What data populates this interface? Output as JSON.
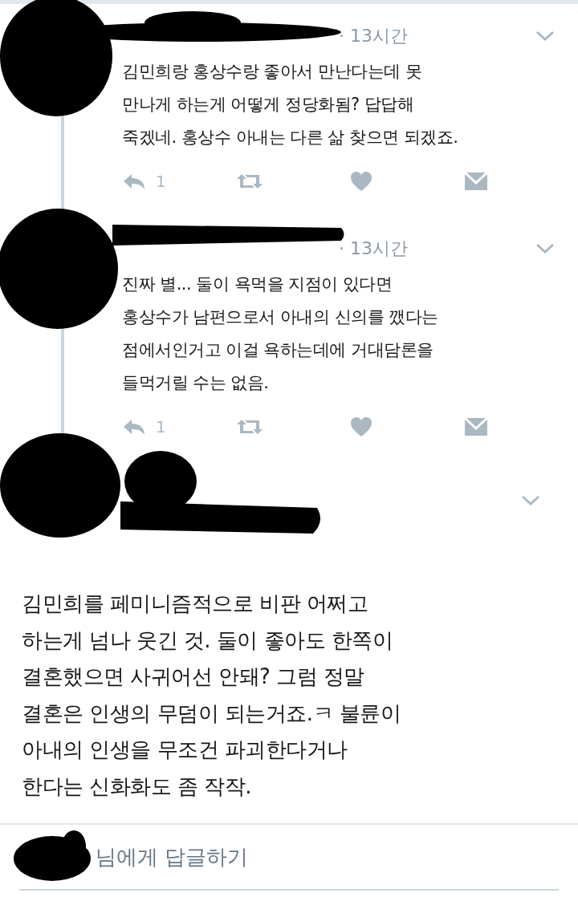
{
  "replies": [
    {
      "time": "· 13시간",
      "lines": [
        "김민희랑 홍상수랑 좋아서 만난다는데 못",
        "만나게 하는게 어떻게 정당화됨? 답답해",
        "죽겠네. 홍상수 아내는 다른 삶 찾으면 되겠죠."
      ],
      "reply_count": "1"
    },
    {
      "time": "· 13시간",
      "lines": [
        "진짜 별... 둘이 욕먹을 지점이 있다면",
        "홍상수가 남편으로서 아내의 신의를 깼다는",
        "점에서인거고 이걸 욕하는데에 거대담론을",
        "들먹거릴 수는 없음."
      ],
      "reply_count": "1"
    }
  ],
  "main_tweet": {
    "lines": [
      "김민희를 페미니즘적으로 비판 어쩌고",
      "하는게 넘나 웃긴 것. 둘이 좋아도 한쪽이",
      "결혼했으면 사귀어선 안돼? 그럼 정말",
      "결혼은 인생의 무덤이 되는거죠.ㅋ 불륜이",
      "아내의 인생을 무조건 파괴한다거나",
      "한다는 신화화도 좀 작작."
    ]
  },
  "reply_box": {
    "placeholder": "님에게 답글하기"
  }
}
